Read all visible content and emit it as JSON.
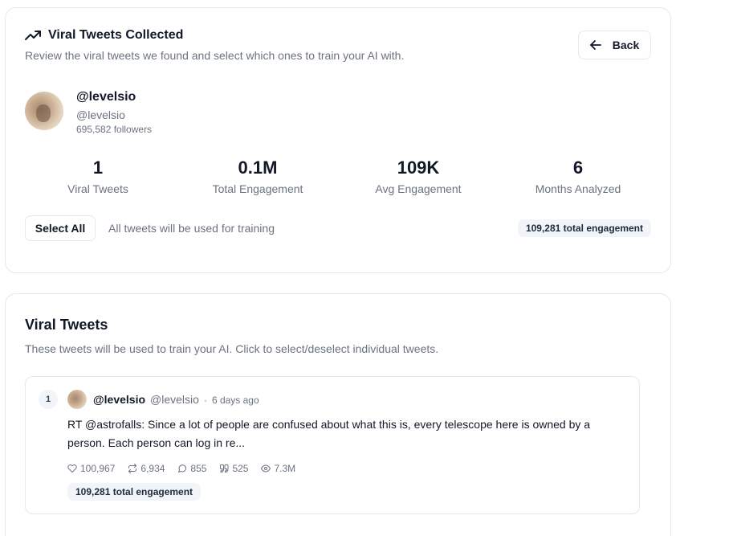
{
  "header": {
    "title": "Viral Tweets Collected",
    "subtitle": "Review the viral tweets we found and select which ones to train your AI with.",
    "back_label": "Back"
  },
  "profile": {
    "name": "@levelsio",
    "handle": "@levelsio",
    "followers": "695,582 followers"
  },
  "stats": [
    {
      "value": "1",
      "label": "Viral Tweets"
    },
    {
      "value": "0.1M",
      "label": "Total Engagement"
    },
    {
      "value": "109K",
      "label": "Avg Engagement"
    },
    {
      "value": "6",
      "label": "Months Analyzed"
    }
  ],
  "selection": {
    "select_all_label": "Select All",
    "note": "All tweets will be used for training",
    "total_badge": "109,281 total engagement"
  },
  "tweets_section": {
    "title": "Viral Tweets",
    "subtitle": "These tweets will be used to train your AI. Click to select/deselect individual tweets."
  },
  "tweets": [
    {
      "index": "1",
      "name": "@levelsio",
      "handle": "@levelsio",
      "separator": "·",
      "time": "6 days ago",
      "text": "RT @astrofalls: Since a lot of people are confused about what this is, every telescope here is owned by a person. Each person can log in re...",
      "likes": "100,967",
      "retweets": "6,934",
      "replies": "855",
      "quotes": "525",
      "views": "7.3M",
      "engagement": "109,281 total engagement"
    }
  ]
}
